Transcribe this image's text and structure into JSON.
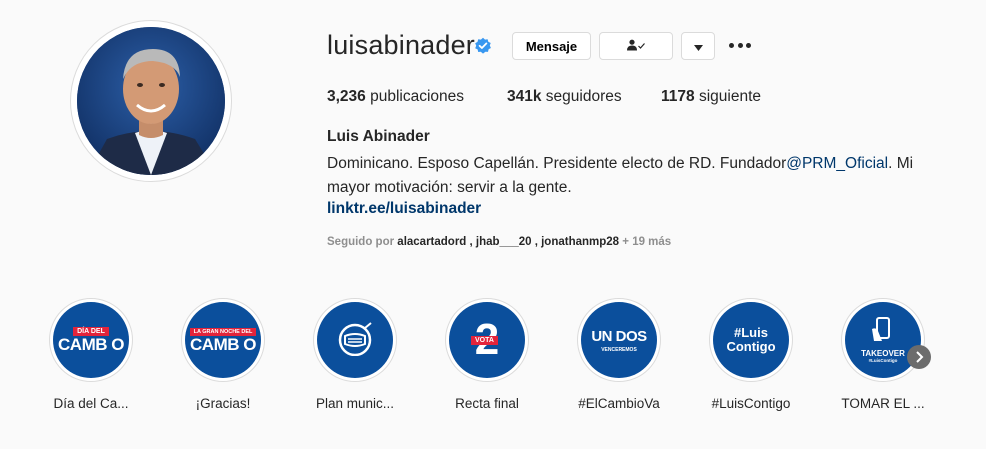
{
  "profile": {
    "username": "luisabinader",
    "name": "Luis Abinader",
    "bio_text": "Dominicano. Esposo Capellán. Presidente electo de RD. Fundador",
    "bio_mention": "@PRM_Oficial",
    "bio_text_after": ". Mi mayor motivación: servir a la gente.",
    "link": "linktr.ee/luisabinader"
  },
  "actions": {
    "message_label": "Mensaje",
    "follow_icon": "user-check-icon",
    "dropdown_icon": "caret-down-icon",
    "more_icon": "more-options-icon"
  },
  "stats": {
    "posts_count": "3,236",
    "posts_label": "publicaciones",
    "followers_count": "341k",
    "followers_label": "seguidores",
    "following_count": "1178",
    "following_label": "siguiente"
  },
  "followed_by": {
    "prefix": "Seguido por",
    "names": "alacartadord , jhab___20 , jonathanmp28",
    "more": "+ 19 más"
  },
  "highlights": [
    {
      "label": "Día del Ca...",
      "art_top": "DÍA DEL",
      "art_main": "CAMB O"
    },
    {
      "label": "¡Gracias!",
      "art_top": "LA GRAN NOCHE DEL",
      "art_main": "CAMB O"
    },
    {
      "label": "Plan munic...",
      "icon": "mask-icon"
    },
    {
      "label": "Recta final",
      "art_top": "VOTA",
      "art_main": "2"
    },
    {
      "label": "#ElCambioVa",
      "art_main": "UN DOS",
      "art_sub": "VENCEREMOS"
    },
    {
      "label": "#LuisContigo",
      "art_top": "#Luis",
      "art_main": "Contigo"
    },
    {
      "label": "TOMAR EL ...",
      "art_main": "TAKEOVER",
      "art_sub": "#LuisContigo"
    }
  ],
  "colors": {
    "verified": "#3897f0",
    "highlight_bg": "#0b4f9c",
    "accent_red": "#e3243b",
    "link": "#00376b"
  }
}
